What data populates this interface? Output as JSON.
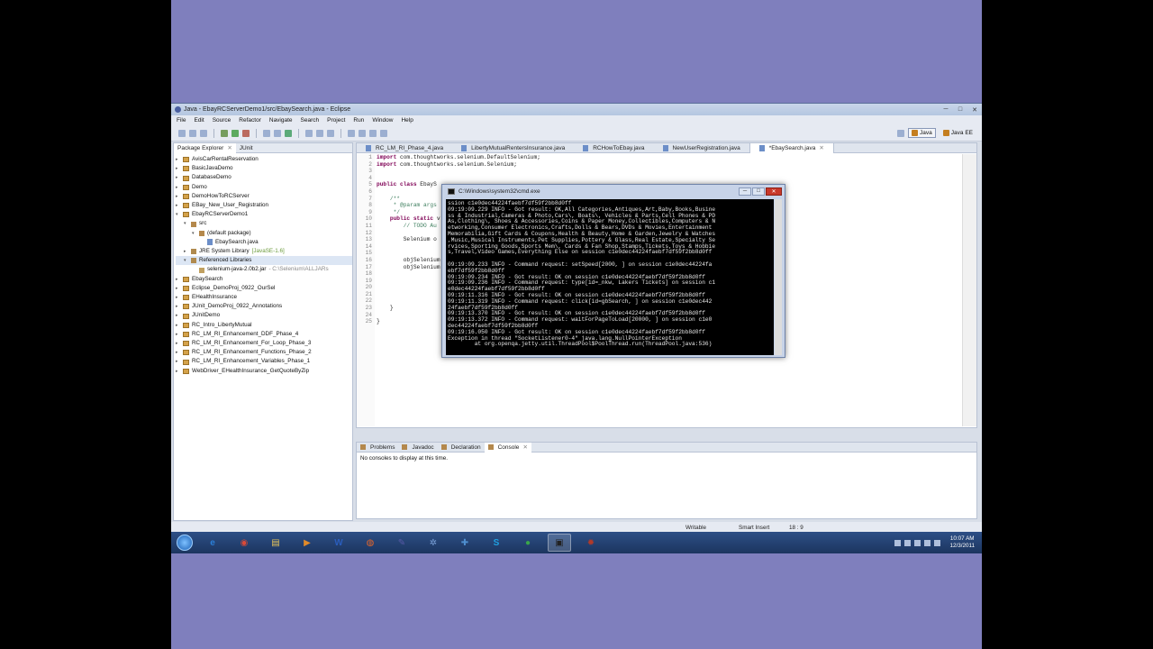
{
  "window": {
    "title": "Java - EbayRCServerDemo1/src/EbaySearch.java - Eclipse",
    "controls": [
      "─",
      "□",
      "✕"
    ]
  },
  "menu": [
    "File",
    "Edit",
    "Source",
    "Refactor",
    "Navigate",
    "Search",
    "Project",
    "Run",
    "Window",
    "Help"
  ],
  "perspectives": {
    "java": "Java",
    "java_ee": "Java EE"
  },
  "package_explorer": {
    "tabs": [
      "Package Explorer",
      "JUnit"
    ],
    "items": [
      {
        "label": "AvisCarRentalReservation",
        "level": 0,
        "type": "project"
      },
      {
        "label": "BasicJavaDemo",
        "level": 0,
        "type": "project"
      },
      {
        "label": "DatabaseDemo",
        "level": 0,
        "type": "project"
      },
      {
        "label": "Demo",
        "level": 0,
        "type": "project"
      },
      {
        "label": "DemoHowToRCServer",
        "level": 0,
        "type": "project"
      },
      {
        "label": "EBay_New_User_Registration",
        "level": 0,
        "type": "project"
      },
      {
        "label": "EbayRCServerDemo1",
        "level": 0,
        "type": "project"
      },
      {
        "label": "src",
        "level": 1,
        "type": "pkg"
      },
      {
        "label": "(default package)",
        "level": 2,
        "type": "pkg"
      },
      {
        "label": "EbaySearch.java",
        "level": 3,
        "type": "java"
      },
      {
        "label": "JRE System Library",
        "extra": "[JavaSE-1.6]",
        "level": 1,
        "type": "lib"
      },
      {
        "label": "Referenced Libraries",
        "level": 1,
        "type": "lib"
      },
      {
        "label": "selenium-java-2.0b2.jar",
        "extra": "- C:\\Selenium\\ALLJARs",
        "level": 2,
        "type": "jar"
      },
      {
        "label": "EbaySearch",
        "level": 0,
        "type": "project"
      },
      {
        "label": "Eclipse_DemoProj_0922_OurSel",
        "level": 0,
        "type": "project"
      },
      {
        "label": "EHealthInsurance",
        "level": 0,
        "type": "project"
      },
      {
        "label": "JUnit_DemoProj_0922_Annotations",
        "level": 0,
        "type": "project"
      },
      {
        "label": "JUnitDemo",
        "level": 0,
        "type": "project"
      },
      {
        "label": "RC_Intro_LibertyMutual",
        "level": 0,
        "type": "project"
      },
      {
        "label": "RC_LM_RI_Enhancement_DDF_Phase_4",
        "level": 0,
        "type": "project"
      },
      {
        "label": "RC_LM_RI_Enhancement_For_Loop_Phase_3",
        "level": 0,
        "type": "project"
      },
      {
        "label": "RC_LM_RI_Enhancement_Functions_Phase_2",
        "level": 0,
        "type": "project"
      },
      {
        "label": "RC_LM_RI_Enhancement_Variables_Phase_1",
        "level": 0,
        "type": "project"
      },
      {
        "label": "WebDriver_EHealthInsurance_GetQuoteByZip",
        "level": 0,
        "type": "project"
      }
    ]
  },
  "editor": {
    "tabs": [
      "RC_LM_RI_Phase_4.java",
      "LibertyMutualRentersInsurance.java",
      "RCHowToEbay.java",
      "NewUserRegistration.java",
      "*EbaySearch.java"
    ],
    "line_numbers": [
      "1",
      "2",
      "3",
      "4",
      "5",
      "6",
      "7",
      "8",
      "9",
      "10",
      "11",
      "12",
      "13",
      "14",
      "15",
      "16",
      "17",
      "18",
      "19",
      "20",
      "21",
      "22",
      "23",
      "24",
      "25"
    ],
    "lines": [
      {
        "parts": [
          {
            "k": "kw",
            "t": "import"
          },
          {
            "k": "",
            "t": " com.thoughtworks.selenium.DefaultSelenium;"
          }
        ]
      },
      {
        "parts": [
          {
            "k": "kw",
            "t": "import"
          },
          {
            "k": "",
            "t": " com.thoughtworks.selenium.Selenium;"
          }
        ]
      },
      {
        "parts": []
      },
      {
        "parts": []
      },
      {
        "parts": [
          {
            "k": "kw",
            "t": "public class"
          },
          {
            "k": "",
            "t": " EbayS"
          }
        ]
      },
      {
        "parts": []
      },
      {
        "parts": [
          {
            "k": "cm",
            "t": "    /**"
          }
        ]
      },
      {
        "parts": [
          {
            "k": "cm",
            "t": "     * @param args"
          }
        ]
      },
      {
        "parts": [
          {
            "k": "cm",
            "t": "     */"
          }
        ]
      },
      {
        "parts": [
          {
            "k": "kw",
            "t": "    public static"
          },
          {
            "k": "",
            "t": " v"
          }
        ]
      },
      {
        "parts": [
          {
            "k": "cm",
            "t": "        // TODO Au"
          }
        ]
      },
      {
        "parts": []
      },
      {
        "parts": [
          {
            "k": "",
            "t": "        Selenium o"
          }
        ]
      },
      {
        "parts": []
      },
      {
        "parts": []
      },
      {
        "parts": [
          {
            "k": "",
            "t": "        objSelenium"
          }
        ]
      },
      {
        "parts": [
          {
            "k": "",
            "t": "        objSelenium"
          }
        ]
      },
      {
        "parts": []
      },
      {
        "parts": []
      },
      {
        "parts": []
      },
      {
        "parts": []
      },
      {
        "parts": []
      },
      {
        "parts": [
          {
            "k": "",
            "t": "    }"
          }
        ]
      },
      {
        "parts": []
      },
      {
        "parts": [
          {
            "k": "",
            "t": "}"
          }
        ]
      }
    ]
  },
  "console": {
    "tabs": [
      "Problems",
      "Javadoc",
      "Declaration",
      "Console"
    ],
    "message": "No consoles to display at this time."
  },
  "status": {
    "writable": "Writable",
    "insert_mode": "Smart Insert",
    "position": "18 : 9"
  },
  "cmd": {
    "title": "C:\\Windows\\system32\\cmd.exe",
    "lines": [
      "ssion c1e0dec44224faebf7df59f2bb8d0ff",
      "09:19:09.229 INFO - Got result: OK,All Categories,Antiques,Art,Baby,Books,Busine",
      "ss & Industrial,Cameras & Photo,Cars\\, Boats\\, Vehicles & Parts,Cell Phones & PD",
      "As,Clothing\\, Shoes & Accessories,Coins & Paper Money,Collectibles,Computers & N",
      "etworking,Consumer Electronics,Crafts,Dolls & Bears,DVDs & Movies,Entertainment",
      "Memorabilia,Gift Cards & Coupons,Health & Beauty,Home & Garden,Jewelry & Watches",
      ",Music,Musical Instruments,Pet Supplies,Pottery & Glass,Real Estate,Specialty Se",
      "rvices,Sporting Goods,Sports Mem\\, Cards & Fan Shop,Stamps,Tickets,Toys & Hobbie",
      "s,Travel,Video Games,Everything Else on session c1e0dec44224faebf7df59f2bb8d0ff",
      "",
      "09:19:09.233 INFO - Command request: setSpeed[2000, ] on session c1e0dec44224fa",
      "ebf7df59f2bb8d0ff",
      "09:19:09.234 INFO - Got result: OK on session c1e0dec44224faebf7df59f2bb8d0ff",
      "09:19:09.236 INFO - Command request: type[id=_nkw, Lakers Tickets] on session c1",
      "e0dec44224faebf7df59f2bb8d0ff",
      "09:19:11.316 INFO - Got result: OK on session c1e0dec44224faebf7df59f2bb8d0ff",
      "09:19:11.319 INFO - Command request: click[id=gbSearch, ] on session c1e0dec442",
      "24faebf7df59f2bb8d0ff",
      "09:19:13.370 INFO - Got result: OK on session c1e0dec44224faebf7df59f2bb8d0ff",
      "09:19:13.372 INFO - Command request: waitForPageToLoad[20000, ] on session c1e0",
      "dec44224faebf7df59f2bb8d0ff",
      "09:19:16.050 INFO - Got result: OK on session c1e0dec44224faebf7df59f2bb8d0ff",
      "Exception in thread \"SocketListener0-4\" java.lang.NullPointerException",
      "        at org.openqa.jetty.util.ThreadPool$PoolThread.run(ThreadPool.java:536)"
    ]
  },
  "taskbar": {
    "icons": [
      {
        "name": "ie-icon",
        "glyph": "e",
        "color": "#2b7fd8"
      },
      {
        "name": "chrome-icon",
        "glyph": "◉",
        "color": "#d94a38"
      },
      {
        "name": "explorer-folder-icon",
        "glyph": "▤",
        "color": "#e6c45a"
      },
      {
        "name": "media-player-icon",
        "glyph": "▶",
        "color": "#e08a2a"
      },
      {
        "name": "word-icon",
        "glyph": "W",
        "color": "#2a5dbc"
      },
      {
        "name": "firefox-icon",
        "glyph": "◍",
        "color": "#e5662a"
      },
      {
        "name": "eclipse-icon",
        "glyph": "✎",
        "color": "#5a5aa8"
      },
      {
        "name": "network-icon",
        "glyph": "✲",
        "color": "#7aa0d8"
      },
      {
        "name": "tools-icon",
        "glyph": "✚",
        "color": "#4f8fd0"
      },
      {
        "name": "skype-icon",
        "glyph": "S",
        "color": "#1fa0e0"
      },
      {
        "name": "globe-icon",
        "glyph": "●",
        "color": "#3aa54a"
      },
      {
        "name": "cmd-icon",
        "glyph": "▣",
        "color": "#222"
      },
      {
        "name": "app-icon",
        "glyph": "✹",
        "color": "#b03a2a"
      }
    ],
    "time": "10:07 AM",
    "date": "12/3/2011"
  }
}
